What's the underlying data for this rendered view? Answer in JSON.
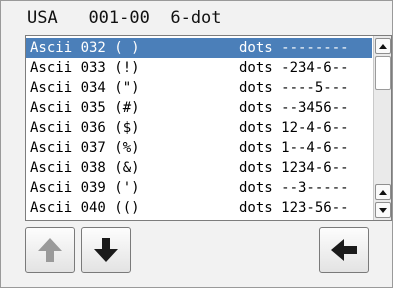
{
  "header": {
    "country": "USA",
    "code": "001-00",
    "mode": "6-dot"
  },
  "list": {
    "rows": [
      {
        "name": "Ascii 032 ( )",
        "dots": "dots --------",
        "selected": true
      },
      {
        "name": "Ascii 033 (!)",
        "dots": "dots -234-6--"
      },
      {
        "name": "Ascii 034 (\")",
        "dots": "dots ----5---"
      },
      {
        "name": "Ascii 035 (#)",
        "dots": "dots --3456--"
      },
      {
        "name": "Ascii 036 ($)",
        "dots": "dots 12-4-6--"
      },
      {
        "name": "Ascii 037 (%)",
        "dots": "dots 1--4-6--"
      },
      {
        "name": "Ascii 038 (&)",
        "dots": "dots 1234-6--"
      },
      {
        "name": "Ascii 039 (')",
        "dots": "dots --3-----"
      },
      {
        "name": "Ascii 040 (()",
        "dots": "dots 123-56--"
      }
    ]
  },
  "toolbar": {
    "up_icon": "arrow-up-icon",
    "down_icon": "arrow-down-icon",
    "back_icon": "arrow-left-icon"
  },
  "colors": {
    "selection": "#4b7fb9",
    "up_arrow_disabled": "#9a9a9a",
    "arrow_enabled": "#1a1a1a"
  }
}
